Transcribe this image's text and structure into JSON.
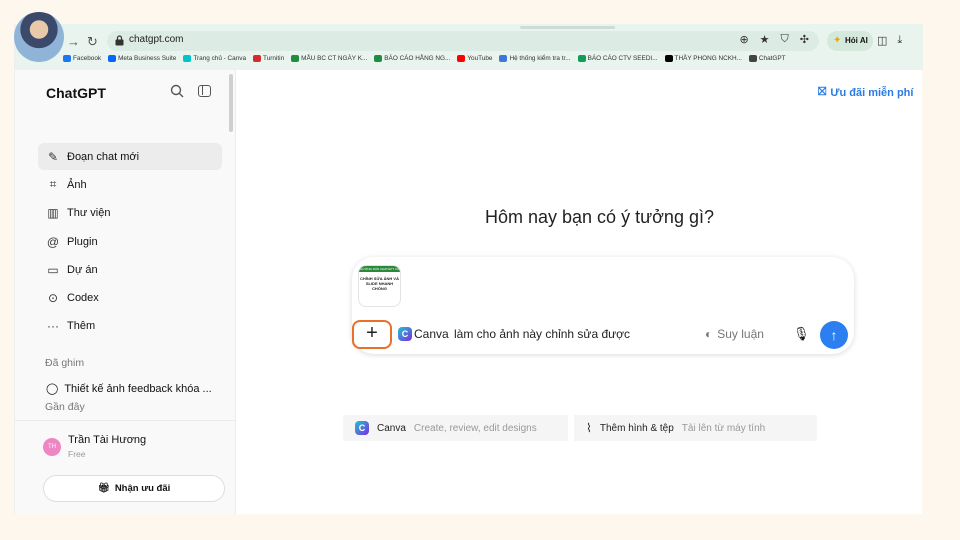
{
  "browser": {
    "url": "chatgpt.com",
    "ai_button_label": "Hỏi AI",
    "bookmarks": [
      {
        "label": "Facebook",
        "color": "#1877f2"
      },
      {
        "label": "Meta Business Suite",
        "color": "#0866ff"
      },
      {
        "label": "Trang chủ - Canva",
        "color": "#00c4cc"
      },
      {
        "label": "Turnitin",
        "color": "#d62b2b"
      },
      {
        "label": "MẪU BC CT NGÀY K...",
        "color": "#1e8e3e"
      },
      {
        "label": "BÁO CÁO HẰNG NG...",
        "color": "#1e8e3e"
      },
      {
        "label": "YouTube",
        "color": "#ff0000"
      },
      {
        "label": "Hệ thống kiểm tra tr...",
        "color": "#3c78d8"
      },
      {
        "label": "BÁO CÁO CTV SEEDI...",
        "color": "#0f9d58"
      },
      {
        "label": "THẦY PHONG NCKH...",
        "color": "#000000"
      },
      {
        "label": "ChatGPT",
        "color": "#444444"
      }
    ]
  },
  "sidebar": {
    "brand": "ChatGPT",
    "items": [
      {
        "label": "Đoạn chat mới",
        "icon": "✎"
      },
      {
        "label": "Ảnh",
        "icon": "⌗"
      },
      {
        "label": "Thư viện",
        "icon": "▥"
      },
      {
        "label": "Plugin",
        "icon": "@"
      },
      {
        "label": "Dự án",
        "icon": "▭"
      },
      {
        "label": "Codex",
        "icon": "⊙"
      },
      {
        "label": "Thêm",
        "icon": "···"
      }
    ],
    "pinned_label": "Đã ghim",
    "pinned_item": "Thiết kế ảnh feedback khóa ...",
    "recent_label": "Gần đây",
    "user": {
      "initials": "TH",
      "name": "Trần Tài Hương",
      "plan": "Free"
    },
    "offer_button": "Nhận ưu đãi"
  },
  "main": {
    "promo": "Ưu đãi miễn phí",
    "headline": "Hôm nay bạn có ý tưởng gì?",
    "composer": {
      "thumb_lines": [
        "HƯỚNG DẪN CHATGPT VÀ CANVA",
        "CHỈNH SỬA ẢNH VÀ",
        "SLIDE NHANH CHÓNG"
      ],
      "plugin_name": "Canva",
      "prompt": "làm cho ảnh này chỉnh sửa được",
      "reasoning_label": "Suy luận"
    },
    "tools": [
      {
        "title": "Canva",
        "desc": "Create, review, edit designs"
      },
      {
        "title": "Thêm hình & tệp",
        "desc": "Tải lên từ máy tính"
      }
    ]
  },
  "colors": {
    "accent": "#2b7ff0",
    "highlight": "#e8702a"
  }
}
